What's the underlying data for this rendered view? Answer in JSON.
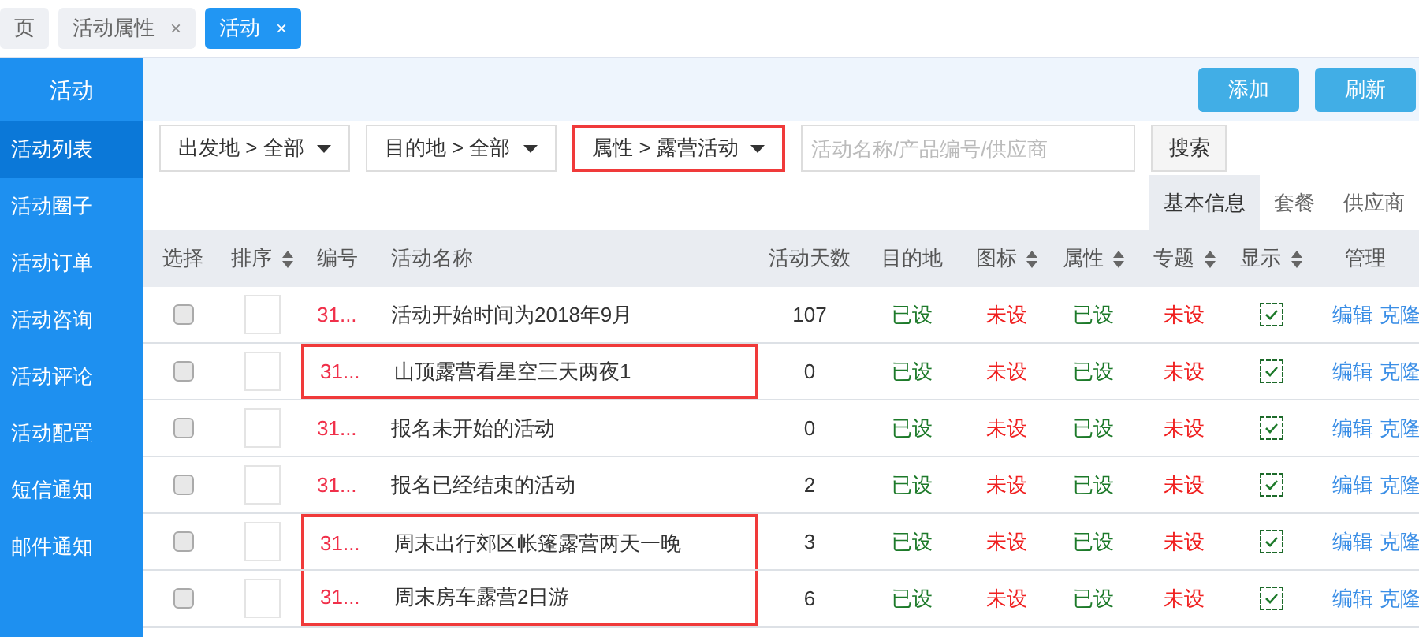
{
  "tabs": [
    {
      "label": "页",
      "selected": false
    },
    {
      "label": "活动属性",
      "close": "×",
      "selected": false
    },
    {
      "label": "活动",
      "close": "×",
      "selected": true
    }
  ],
  "sidebar": {
    "title": "活动",
    "items": [
      {
        "label": "活动列表",
        "selected": true
      },
      {
        "label": "活动圈子",
        "selected": false
      },
      {
        "label": "活动订单",
        "selected": false
      },
      {
        "label": "活动咨询",
        "selected": false
      },
      {
        "label": "活动评论",
        "selected": false
      },
      {
        "label": "活动配置",
        "selected": false
      },
      {
        "label": "短信通知",
        "selected": false
      },
      {
        "label": "邮件通知",
        "selected": false
      }
    ]
  },
  "actions": [
    "添加",
    "刷新"
  ],
  "filters": [
    {
      "label": "出发地 > 全部",
      "highlighted": false
    },
    {
      "label": "目的地 > 全部",
      "highlighted": false
    },
    {
      "label": "属性 > 露营活动",
      "highlighted": true
    }
  ],
  "search": {
    "placeholder": "活动名称/产品编号/供应商",
    "button": "搜索"
  },
  "view_tabs": [
    {
      "label": "基本信息",
      "selected": true
    },
    {
      "label": "套餐",
      "selected": false
    },
    {
      "label": "供应商",
      "selected": false
    }
  ],
  "table": {
    "columns": [
      {
        "label": "选择",
        "sortable": false
      },
      {
        "label": "排序",
        "sortable": true
      },
      {
        "label": "编号",
        "sortable": false
      },
      {
        "label": "活动名称",
        "sortable": false
      },
      {
        "label": "活动天数",
        "sortable": false
      },
      {
        "label": "目的地",
        "sortable": false
      },
      {
        "label": "图标",
        "sortable": true
      },
      {
        "label": "属性",
        "sortable": true
      },
      {
        "label": "专题",
        "sortable": true
      },
      {
        "label": "显示",
        "sortable": true
      },
      {
        "label": "管理",
        "sortable": false
      }
    ],
    "rows": [
      {
        "checked": false,
        "code": "31...",
        "name": "活动开始时间为2018年9月",
        "days": "107",
        "flags": [
          {
            "text": "已设",
            "set": true
          },
          {
            "text": "未设",
            "set": false
          },
          {
            "text": "已设",
            "set": true
          },
          {
            "text": "未设",
            "set": false
          }
        ],
        "shown": true,
        "links": [
          "编辑",
          "克隆"
        ],
        "highlighted": false
      },
      {
        "checked": false,
        "code": "31...",
        "name": "山顶露营看星空三天两夜1",
        "days": "0",
        "flags": [
          {
            "text": "已设",
            "set": true
          },
          {
            "text": "未设",
            "set": false
          },
          {
            "text": "已设",
            "set": true
          },
          {
            "text": "未设",
            "set": false
          }
        ],
        "shown": true,
        "links": [
          "编辑",
          "克隆"
        ],
        "highlighted": true
      },
      {
        "checked": false,
        "code": "31...",
        "name": "报名未开始的活动",
        "days": "0",
        "flags": [
          {
            "text": "已设",
            "set": true
          },
          {
            "text": "未设",
            "set": false
          },
          {
            "text": "已设",
            "set": true
          },
          {
            "text": "未设",
            "set": false
          }
        ],
        "shown": true,
        "links": [
          "编辑",
          "克隆"
        ],
        "highlighted": false
      },
      {
        "checked": false,
        "code": "31...",
        "name": "报名已经结束的活动",
        "days": "2",
        "flags": [
          {
            "text": "已设",
            "set": true
          },
          {
            "text": "未设",
            "set": false
          },
          {
            "text": "已设",
            "set": true
          },
          {
            "text": "未设",
            "set": false
          }
        ],
        "shown": true,
        "links": [
          "编辑",
          "克隆"
        ],
        "highlighted": false
      },
      {
        "checked": false,
        "code": "31...",
        "name": "周末出行郊区帐篷露营两天一晚",
        "days": "3",
        "flags": [
          {
            "text": "已设",
            "set": true
          },
          {
            "text": "未设",
            "set": false
          },
          {
            "text": "已设",
            "set": true
          },
          {
            "text": "未设",
            "set": false
          }
        ],
        "shown": true,
        "links": [
          "编辑",
          "克隆"
        ],
        "highlighted": true
      },
      {
        "checked": false,
        "code": "31...",
        "name": "周末房车露营2日游",
        "days": "6",
        "flags": [
          {
            "text": "已设",
            "set": true
          },
          {
            "text": "未设",
            "set": false
          },
          {
            "text": "已设",
            "set": true
          },
          {
            "text": "未设",
            "set": false
          }
        ],
        "shown": true,
        "links": [
          "编辑",
          "克隆"
        ],
        "highlighted": true
      }
    ]
  }
}
